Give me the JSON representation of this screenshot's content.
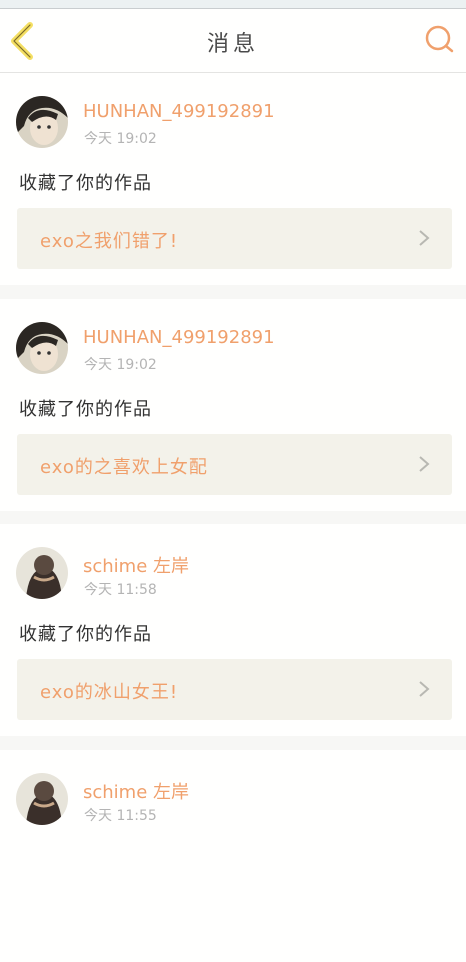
{
  "header": {
    "title": "消息",
    "back_icon": "chevron-left-icon",
    "search_icon": "search-icon",
    "accent_color": "#f0a06c"
  },
  "messages": [
    {
      "username": "HUNHAN_499192891",
      "time": "今天 19:02",
      "action": "收藏了你的作品",
      "work_title": "exo之我们错了!"
    },
    {
      "username": "HUNHAN_499192891",
      "time": "今天 19:02",
      "action": "收藏了你的作品",
      "work_title": "exo的之喜欢上女配"
    },
    {
      "username": "schime 左岸",
      "time": "今天 11:58",
      "action": "收藏了你的作品",
      "work_title": "exo的冰山女王!"
    },
    {
      "username": "schime 左岸",
      "time": "今天 11:55",
      "action": "",
      "work_title": ""
    }
  ]
}
